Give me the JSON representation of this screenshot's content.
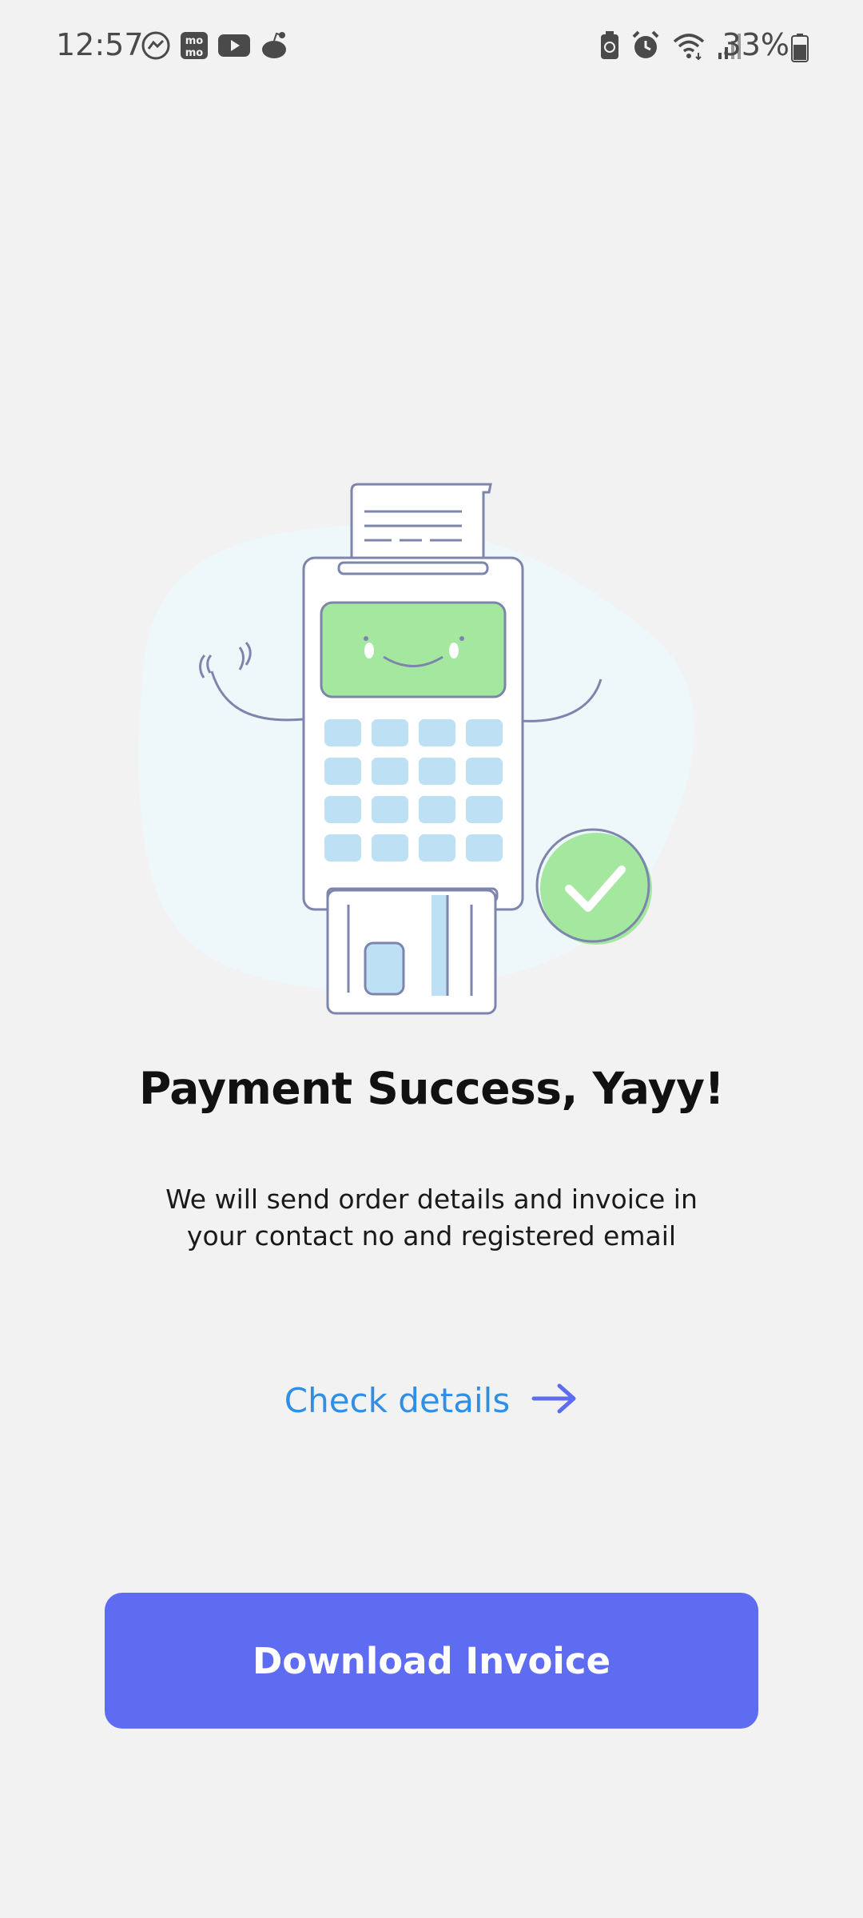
{
  "status_bar": {
    "time": "12:57",
    "left_icons": [
      "messenger-icon",
      "momo-icon",
      "youtube-icon",
      "reddit-icon"
    ],
    "right_icons": [
      "battery-saver-icon",
      "alarm-icon",
      "wifi-icon",
      "signal-icon"
    ],
    "battery_percent": "33%"
  },
  "main": {
    "title": "Payment Success, Yayy!",
    "subtitle": "We will send order details and invoice in your contact no and registered email",
    "check_details_label": "Check details",
    "download_button_label": "Download Invoice"
  },
  "colors": {
    "background": "#f2f2f2",
    "accent": "#5d6cf1",
    "link": "#2f8ee6",
    "success_green": "#a4e8a0",
    "key_blue": "#bde0f5"
  }
}
